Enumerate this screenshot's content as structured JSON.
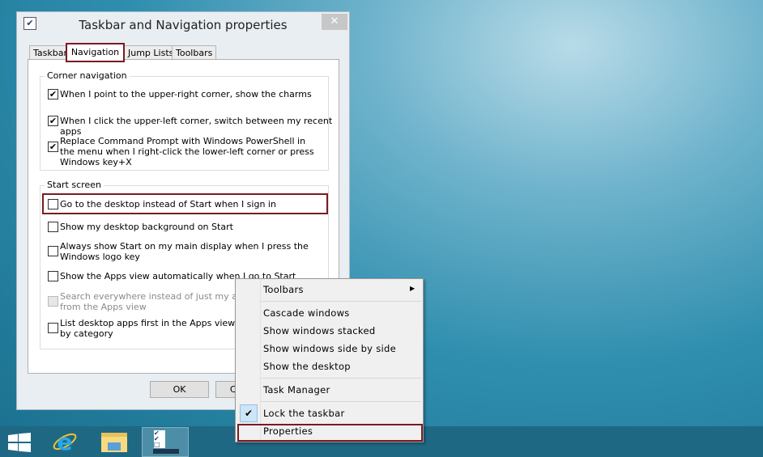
{
  "dialog": {
    "title": "Taskbar and Navigation properties",
    "close": "✕",
    "tabs": [
      "Taskbar",
      "Navigation",
      "Jump Lists",
      "Toolbars"
    ],
    "selected_tab": "Navigation",
    "corner": {
      "label": "Corner navigation",
      "items": [
        {
          "text": "When I point to the upper-right corner, show the charms",
          "checked": true
        },
        {
          "text": "When I click the upper-left corner, switch between my recent apps",
          "checked": true
        },
        {
          "text": "Replace Command Prompt with Windows PowerShell in the menu when I right-click the lower-left corner or press Windows key+X",
          "checked": true
        }
      ]
    },
    "start": {
      "label": "Start screen",
      "items": [
        {
          "text": "Go to the desktop instead of Start when I sign in",
          "checked": false
        },
        {
          "text": "Show my desktop background on Start",
          "checked": false
        },
        {
          "text": "Always show Start on my main display when I press the Windows logo key",
          "checked": false
        },
        {
          "text": "Show the Apps view automatically when I go to Start",
          "checked": false
        },
        {
          "text": "Search everywhere instead of just my apps when I search from the Apps view",
          "checked": false,
          "disabled": true
        },
        {
          "text": "List desktop apps first in the Apps view when it's sorted by category",
          "checked": false
        }
      ]
    },
    "ok": "OK",
    "cancel": "Cancel"
  },
  "menu": {
    "items": [
      "Toolbars",
      "Cascade windows",
      "Show windows stacked",
      "Show windows side by side",
      "Show the desktop",
      "Task Manager",
      "Lock the taskbar",
      "Properties"
    ],
    "lock_checked": true,
    "submenu_arrow": "▶"
  },
  "taskbar": {
    "icons": [
      "windows-start-icon",
      "internet-explorer-icon",
      "file-explorer-icon",
      "taskbar-properties-icon"
    ]
  },
  "highlight_color": "#7a1a22"
}
